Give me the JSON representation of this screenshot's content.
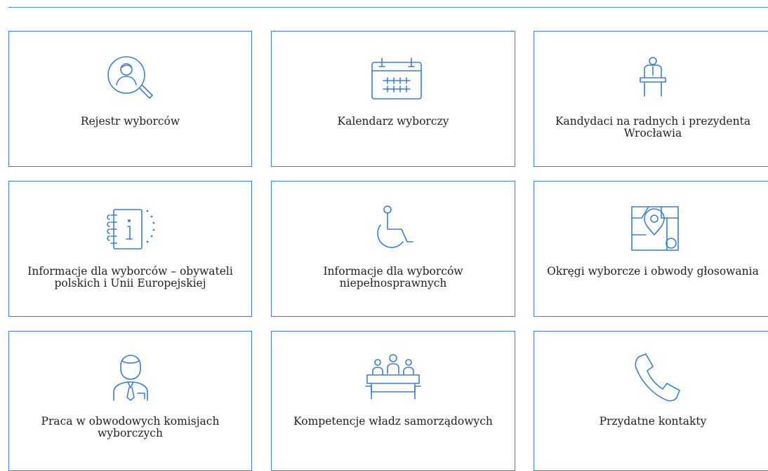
{
  "tiles": [
    {
      "label": "Rejestr wyborców",
      "icon": "voter-register-search-icon"
    },
    {
      "label": "Kalendarz wyborczy",
      "icon": "calendar-icon"
    },
    {
      "label": "Kandydaci na radnych i prezydenta Wrocławia",
      "icon": "candidate-podium-icon"
    },
    {
      "label": "Informacje dla wyborców – obywateli polskich i Unii Europejskiej",
      "icon": "info-notebook-icon"
    },
    {
      "label": "Informacje dla wyborców niepełnosprawnych",
      "icon": "wheelchair-icon"
    },
    {
      "label": "Okręgi wyborcze i obwody głosowania",
      "icon": "map-pin-icon"
    },
    {
      "label": "Praca w obwodowych komisjach wyborczych",
      "icon": "officer-person-icon"
    },
    {
      "label": "Kompetencje władz samorządowych",
      "icon": "council-meeting-icon"
    },
    {
      "label": "Przydatne kontakty",
      "icon": "phone-icon"
    }
  ],
  "colors": {
    "accent": "#3d7fd0",
    "text": "#222222",
    "background": "#ffffff"
  }
}
